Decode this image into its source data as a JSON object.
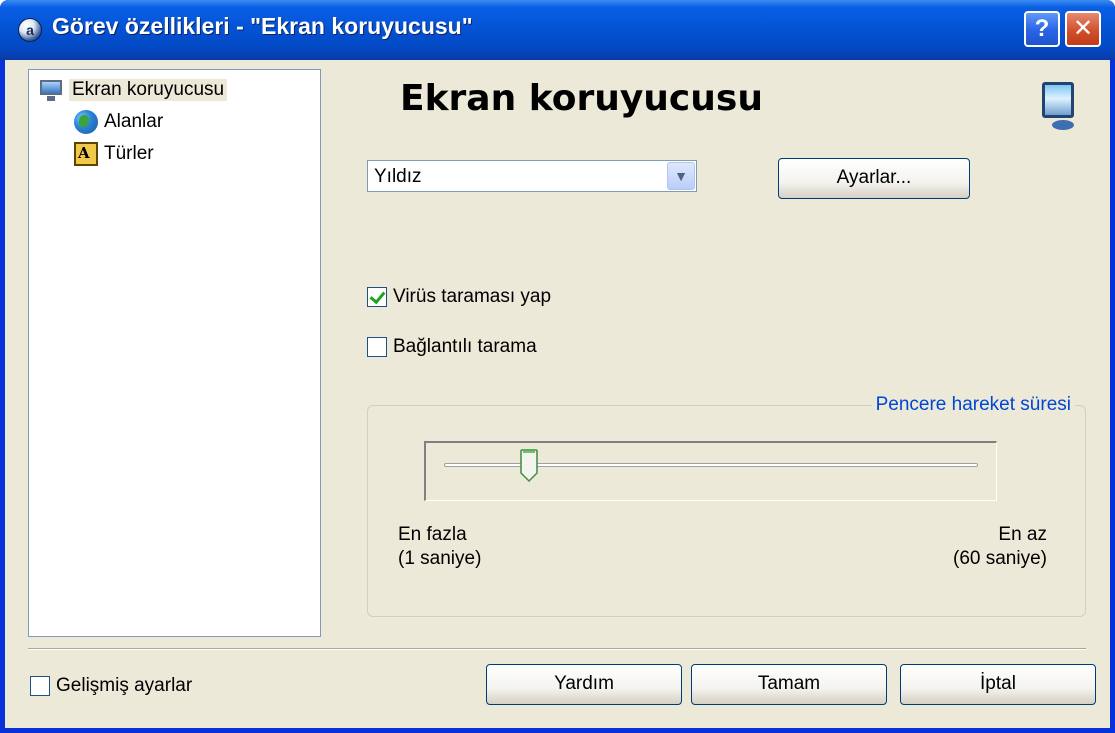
{
  "window": {
    "title": "Görev özellikleri - \"Ekran koruyucusu\"",
    "help_label": "?",
    "close_label": "✕"
  },
  "tree": {
    "items": [
      {
        "label": "Ekran koruyucusu",
        "icon": "monitor-icon",
        "selected": true
      },
      {
        "label": "Alanlar",
        "icon": "globe-icon"
      },
      {
        "label": "Türler",
        "icon": "types-icon",
        "icon_text": "A"
      }
    ]
  },
  "main": {
    "heading": "Ekran koruyucusu",
    "screensaver_select": {
      "value": "Yıldız"
    },
    "settings_button": "Ayarlar...",
    "virus_scan": {
      "label": "Virüs taraması yap",
      "checked": true
    },
    "connected_scan": {
      "label": "Bağlantılı tarama",
      "checked": false
    },
    "window_motion_group": {
      "legend": "Pencere hareket süresi",
      "slider_level": 0.16,
      "left_label_line1": "En fazla",
      "left_label_line2": "(1 saniye)",
      "right_label_line1": "En az",
      "right_label_line2": "(60 saniye)"
    }
  },
  "footer": {
    "advanced": {
      "label": "Gelişmiş ayarlar",
      "checked": false
    },
    "help_button": "Yardım",
    "ok_button": "Tamam",
    "cancel_button": "İptal"
  },
  "colors": {
    "titlebar": "#0453d6",
    "dialog_bg": "#ece9d8",
    "legend_text": "#0046d5",
    "check_mark": "#21a121"
  }
}
